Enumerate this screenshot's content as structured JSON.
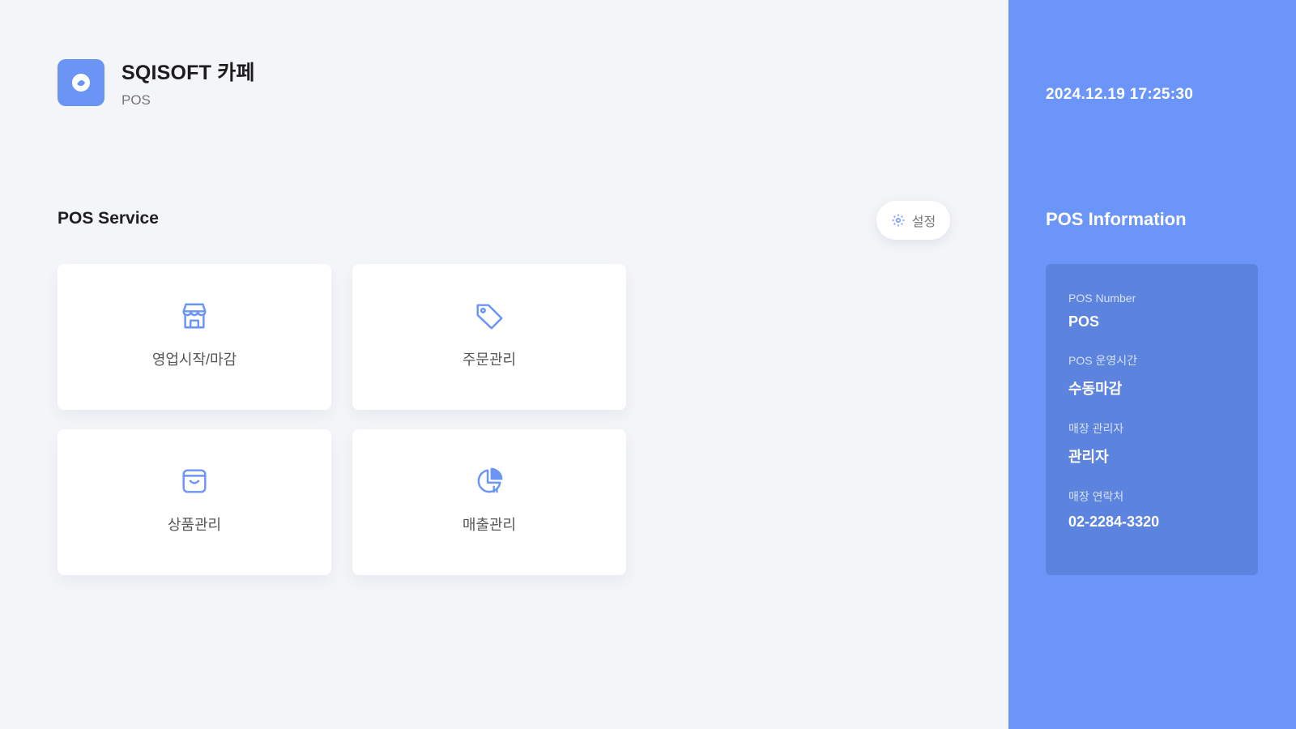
{
  "header": {
    "app_name": "SQISOFT 카페",
    "app_sub": "POS",
    "logo_icon": "cafe-logo-icon"
  },
  "service": {
    "title": "POS Service",
    "settings_label": "설정",
    "settings_icon": "gear-icon",
    "cards": [
      {
        "label": "영업시작/마감",
        "icon": "store-icon"
      },
      {
        "label": "주문관리",
        "icon": "tag-icon"
      },
      {
        "label": "상품관리",
        "icon": "shopping-bag-icon"
      },
      {
        "label": "매출관리",
        "icon": "pie-chart-icon"
      }
    ]
  },
  "sidebar": {
    "datetime": "2024.12.19  17:25:30",
    "info_title": "POS Information",
    "items": [
      {
        "label": "POS Number",
        "value": "POS"
      },
      {
        "label": "POS 운영시간",
        "value": "수동마감"
      },
      {
        "label": "매장 관리자",
        "value": "관리자"
      },
      {
        "label": "매장 연락처",
        "value": "02-2284-3320"
      }
    ]
  },
  "colors": {
    "accent": "#6b95f8",
    "info_box": "#5c83dd",
    "icon": "#6b95f5",
    "background": "#f4f5f8"
  }
}
